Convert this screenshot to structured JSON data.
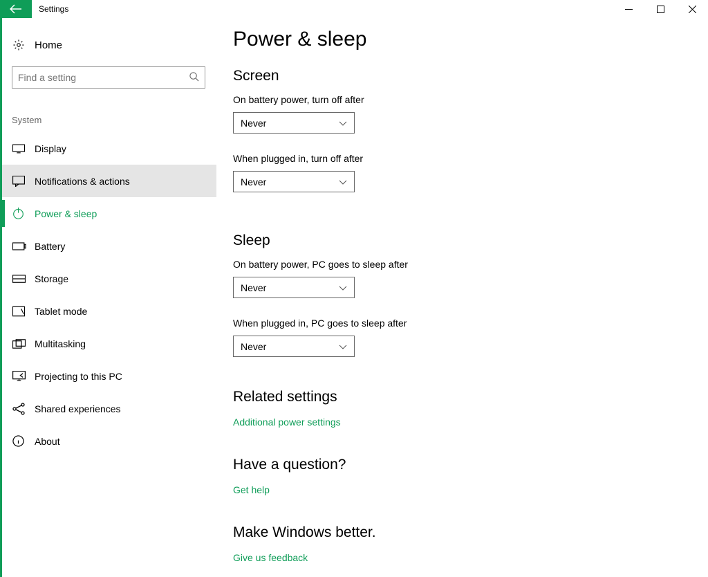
{
  "window": {
    "title": "Settings"
  },
  "sidebar": {
    "home_label": "Home",
    "search_placeholder": "Find a setting",
    "group_title": "System",
    "items": [
      {
        "label": "Display"
      },
      {
        "label": "Notifications & actions"
      },
      {
        "label": "Power & sleep"
      },
      {
        "label": "Battery"
      },
      {
        "label": "Storage"
      },
      {
        "label": "Tablet mode"
      },
      {
        "label": "Multitasking"
      },
      {
        "label": "Projecting to this PC"
      },
      {
        "label": "Shared experiences"
      },
      {
        "label": "About"
      }
    ]
  },
  "main": {
    "page_title": "Power & sleep",
    "screen": {
      "heading": "Screen",
      "battery_label": "On battery power, turn off after",
      "battery_value": "Never",
      "plugged_label": "When plugged in, turn off after",
      "plugged_value": "Never"
    },
    "sleep": {
      "heading": "Sleep",
      "battery_label": "On battery power, PC goes to sleep after",
      "battery_value": "Never",
      "plugged_label": "When plugged in, PC goes to sleep after",
      "plugged_value": "Never"
    },
    "related": {
      "heading": "Related settings",
      "link": "Additional power settings"
    },
    "question": {
      "heading": "Have a question?",
      "link": "Get help"
    },
    "better": {
      "heading": "Make Windows better.",
      "link": "Give us feedback"
    }
  }
}
